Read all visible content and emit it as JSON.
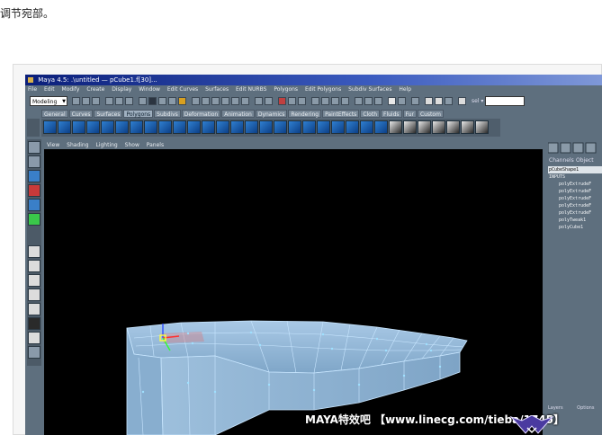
{
  "page": {
    "caption": "调节宛部。"
  },
  "maya": {
    "title": "Maya 4.5: .\\untitled  —  pCube1.f[30]...",
    "menu": [
      "File",
      "Edit",
      "Modify",
      "Create",
      "Display",
      "Window",
      "Edit Curves",
      "Surfaces",
      "Edit NURBS",
      "Polygons",
      "Edit Polygons",
      "Subdiv Surfaces",
      "Help"
    ],
    "mode_select": "Modeling",
    "field_label": "sel ▾",
    "shelf_tabs": [
      "General",
      "Curves",
      "Surfaces",
      "Polygons",
      "Subdivs",
      "Deformation",
      "Animation",
      "Dynamics",
      "Rendering",
      "PaintEffects",
      "Cloth",
      "Fluids",
      "Fur",
      "Custom"
    ],
    "active_shelf_tab": "Polygons",
    "panel_menu": [
      "View",
      "Shading",
      "Lighting",
      "Show",
      "Panels"
    ],
    "channel_box": {
      "tabs": [
        "Channels",
        "Object"
      ],
      "selected_object": "pCubeShape1",
      "inputs_label": "INPUTS",
      "inputs": [
        "polyExtrudeF",
        "polyExtrudeF",
        "polyExtrudeF",
        "polyExtrudeF",
        "polyExtrudeF",
        "polyTweak1",
        "polyCube1"
      ],
      "bottom_options": [
        "Layers",
        "Options"
      ]
    }
  },
  "watermark": "MAYA特效吧 【www.linecg.com/tieba/1745】",
  "colors": {
    "ui_bg": "#5e6f7e",
    "viewport_bg": "#000000",
    "mesh_fill": "#8fb6d8",
    "mesh_edge": "#c8e6ff",
    "title_bar": "#0b1f7a"
  }
}
